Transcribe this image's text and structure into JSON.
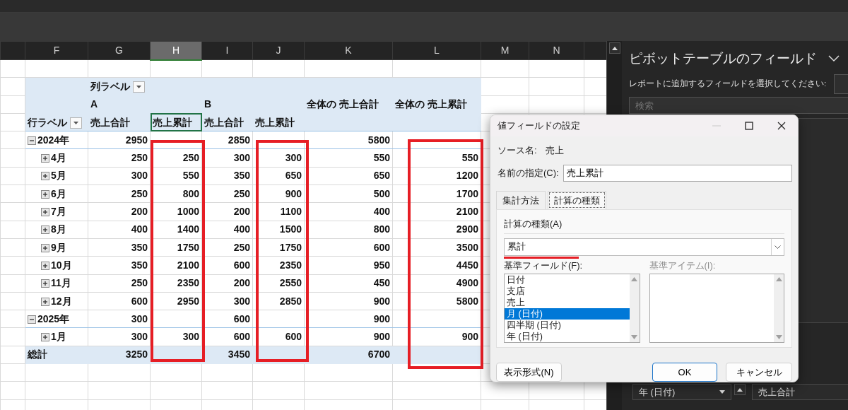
{
  "sheet": {
    "columns": [
      {
        "label": "F",
        "selected": false
      },
      {
        "label": "G",
        "selected": false
      },
      {
        "label": "H",
        "selected": true
      },
      {
        "label": "I",
        "selected": false
      },
      {
        "label": "J",
        "selected": false
      },
      {
        "label": "K",
        "selected": false
      },
      {
        "label": "L",
        "selected": false
      },
      {
        "label": "M",
        "selected": false
      },
      {
        "label": "N",
        "selected": false
      }
    ]
  },
  "pivot": {
    "column_label_header": "列ラベル",
    "row_label_header": "行ラベル",
    "column_groups": [
      "A",
      "B"
    ],
    "grand_headers": [
      "全体の 売上合計",
      "全体の 売上累計"
    ],
    "measures": [
      {
        "label": "売上合計",
        "selected": false
      },
      {
        "label": "売上累計",
        "selected": true
      },
      {
        "label": "売上合計",
        "selected": false
      },
      {
        "label": "売上累計",
        "selected": false
      }
    ],
    "rows": [
      {
        "kind": "year",
        "label": "2024年",
        "expanded": true,
        "values": {
          "G": "2950",
          "I": "2850",
          "K": "5800"
        }
      },
      {
        "kind": "month",
        "label": "4月",
        "expanded": false,
        "values": [
          "250",
          "250",
          "300",
          "300",
          "550",
          "550"
        ]
      },
      {
        "kind": "month",
        "label": "5月",
        "expanded": false,
        "values": [
          "300",
          "550",
          "350",
          "650",
          "650",
          "1200"
        ]
      },
      {
        "kind": "month",
        "label": "6月",
        "expanded": false,
        "values": [
          "250",
          "800",
          "250",
          "900",
          "500",
          "1700"
        ]
      },
      {
        "kind": "month",
        "label": "7月",
        "expanded": false,
        "values": [
          "200",
          "1000",
          "200",
          "1100",
          "400",
          "2100"
        ]
      },
      {
        "kind": "month",
        "label": "8月",
        "expanded": false,
        "values": [
          "400",
          "1400",
          "400",
          "1500",
          "800",
          "2900"
        ]
      },
      {
        "kind": "month",
        "label": "9月",
        "expanded": false,
        "values": [
          "350",
          "1750",
          "250",
          "1750",
          "600",
          "3500"
        ]
      },
      {
        "kind": "month",
        "label": "10月",
        "expanded": false,
        "values": [
          "350",
          "2100",
          "600",
          "2350",
          "950",
          "4450"
        ]
      },
      {
        "kind": "month",
        "label": "11月",
        "expanded": false,
        "values": [
          "250",
          "2350",
          "200",
          "2550",
          "450",
          "4900"
        ]
      },
      {
        "kind": "month",
        "label": "12月",
        "expanded": false,
        "values": [
          "600",
          "2950",
          "300",
          "2850",
          "900",
          "5800"
        ]
      },
      {
        "kind": "year",
        "label": "2025年",
        "expanded": true,
        "values": {
          "G": "300",
          "I": "600",
          "K": "900"
        }
      },
      {
        "kind": "month",
        "label": "1月",
        "expanded": false,
        "values": [
          "300",
          "300",
          "600",
          "600",
          "900",
          "900"
        ]
      },
      {
        "kind": "total",
        "label": "総計",
        "values": {
          "G": "3250",
          "I": "3450",
          "K": "6700"
        }
      }
    ]
  },
  "field_panel": {
    "title": "ピボットテーブルのフィールド",
    "subtitle": "レポートに追加するフィールドを選択してください:",
    "search": {
      "placeholder": "検索"
    },
    "row_field": "年 (日付)",
    "value_field": "売上合計"
  },
  "dialog": {
    "title": "値フィールドの設定",
    "minimize_disabled": true,
    "source_label": "ソース名:",
    "source_value": "売上",
    "name_label": "名前の指定(C):",
    "name_value": "売上累計",
    "tabs": [
      {
        "label": "集計方法",
        "selected": false
      },
      {
        "label": "計算の種類",
        "selected": true
      }
    ],
    "calc_label": "計算の種類(A)",
    "calc_value": "累計",
    "base_field_label": "基準フィールド(F):",
    "base_fields": [
      {
        "label": "日付",
        "selected": false
      },
      {
        "label": "支店",
        "selected": false
      },
      {
        "label": "売上",
        "selected": false
      },
      {
        "label": "月 (日付)",
        "selected": true
      },
      {
        "label": "四半期 (日付)",
        "selected": false
      },
      {
        "label": "年 (日付)",
        "selected": false
      }
    ],
    "base_item_label": "基準アイテム(I):",
    "base_item_disabled": true,
    "buttons": [
      {
        "label": "表示形式(N)",
        "default": false
      },
      {
        "label": "OK",
        "default": true
      },
      {
        "label": "キャンセル",
        "default": false
      }
    ]
  }
}
